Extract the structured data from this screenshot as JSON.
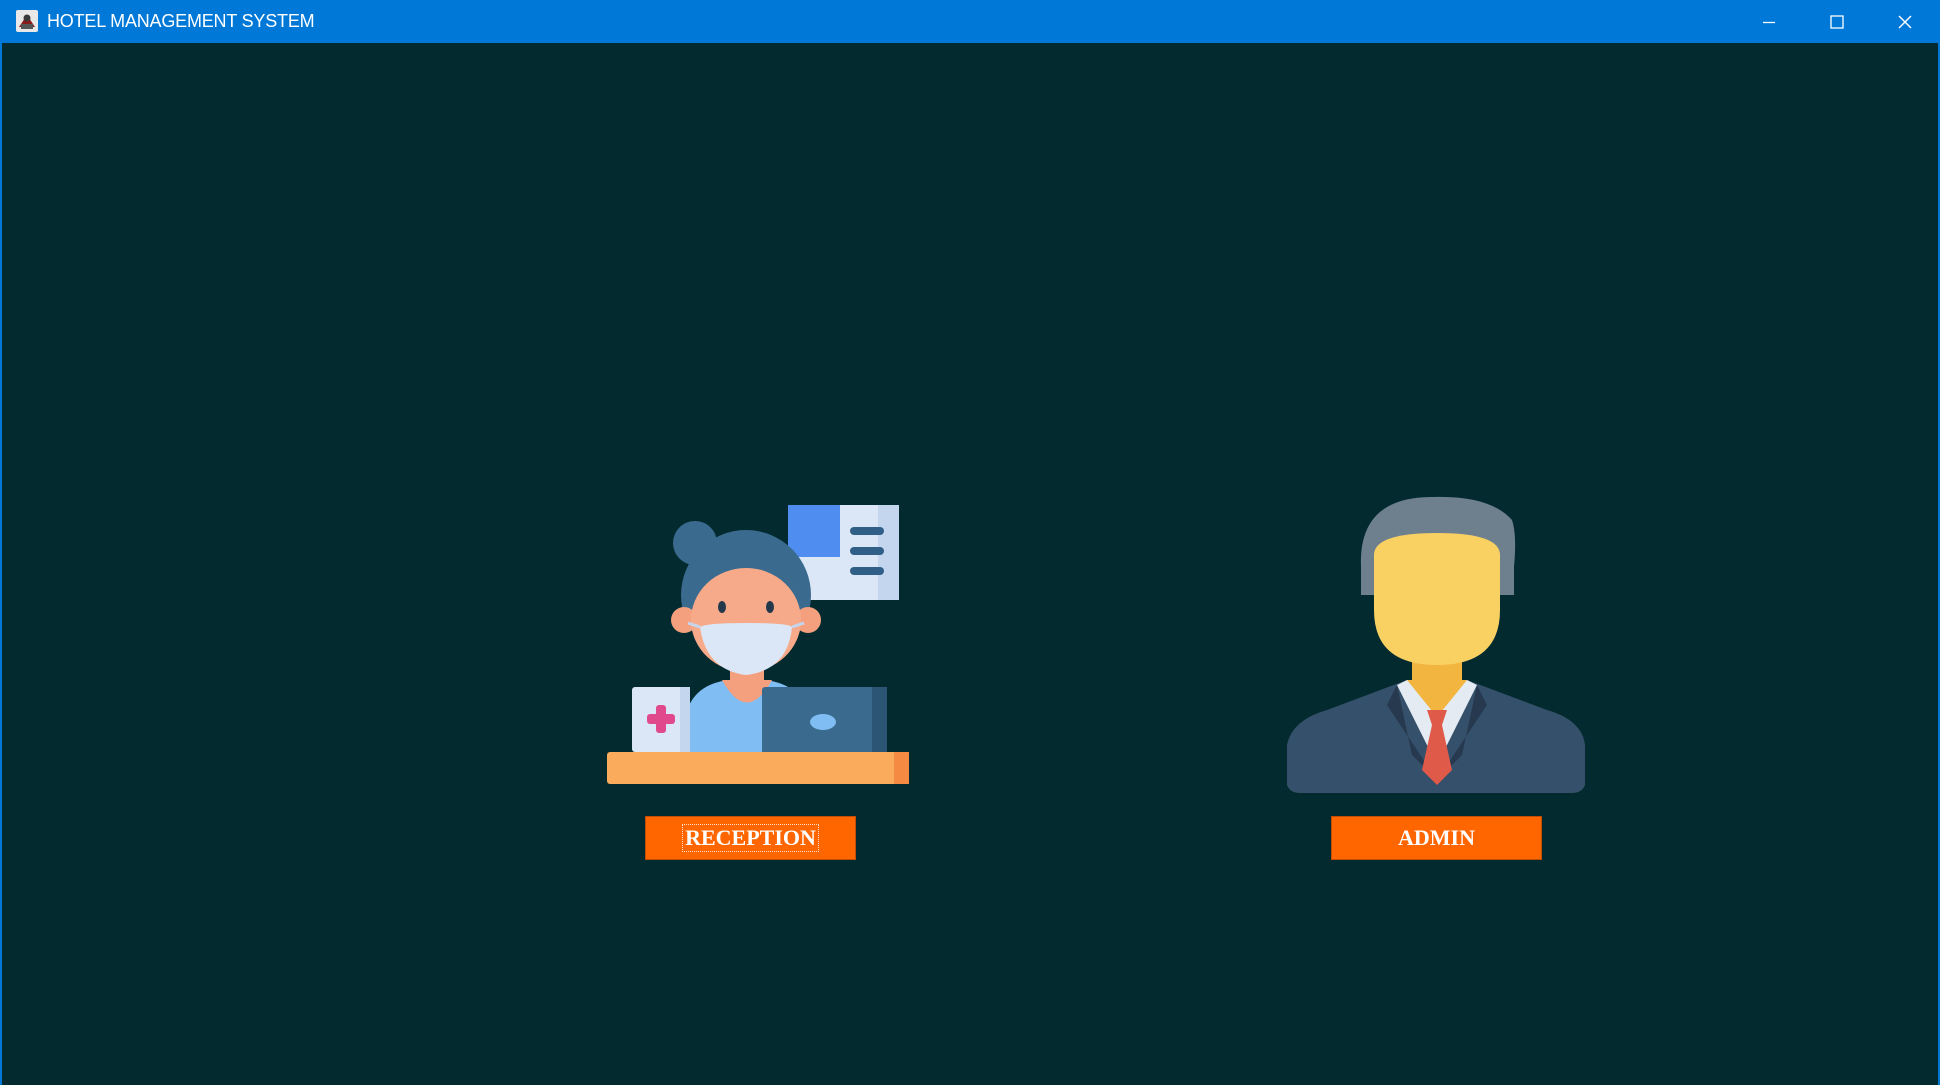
{
  "window": {
    "title": "HOTEL MANAGEMENT SYSTEM",
    "controls": {
      "minimize_icon": "minimize-icon",
      "maximize_icon": "maximize-icon",
      "close_icon": "close-icon"
    }
  },
  "main": {
    "roles": [
      {
        "label": "RECEPTION",
        "icon": "receptionist-illustration"
      },
      {
        "label": "ADMIN",
        "icon": "admin-illustration"
      }
    ]
  },
  "colors": {
    "titlebar": "#0078d7",
    "background": "#022a2f",
    "button": "#ff6600",
    "button_text": "#ffffff"
  }
}
